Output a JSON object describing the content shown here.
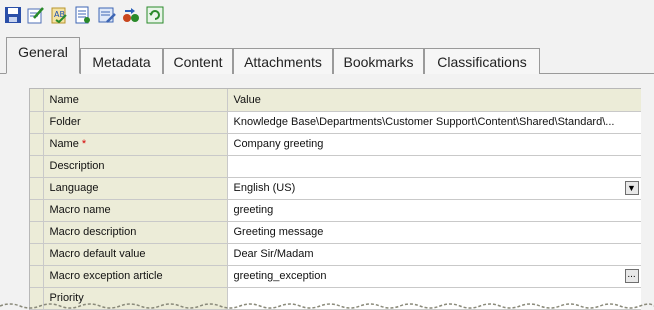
{
  "toolbar": {
    "icons": [
      "save-icon",
      "edit-icon",
      "spell-check-icon",
      "document-list-icon",
      "publish-icon",
      "compare-icon",
      "refresh-icon"
    ]
  },
  "tabs": [
    "General",
    "Metadata",
    "Content",
    "Attachments",
    "Bookmarks",
    "Classifications"
  ],
  "grid": {
    "header": {
      "name": "Name",
      "value": "Value"
    },
    "rows": [
      {
        "name": "Folder",
        "value": "Knowledge Base\\Departments\\Customer Support\\Content\\Shared\\Standard\\..."
      },
      {
        "name": "Name",
        "required_marker": "*",
        "value": "Company greeting"
      },
      {
        "name": "Description",
        "value": ""
      },
      {
        "name": "Language",
        "value": "English (US)"
      },
      {
        "name": "Macro name",
        "value": "greeting"
      },
      {
        "name": "Macro description",
        "value": "Greeting message"
      },
      {
        "name": "Macro default value",
        "value": "Dear Sir/Madam"
      },
      {
        "name": "Macro exception article",
        "value": "greeting_exception"
      },
      {
        "name": "Priority",
        "value": ""
      }
    ],
    "dropdown_glyph": "▼",
    "ellipsis_glyph": "..."
  }
}
